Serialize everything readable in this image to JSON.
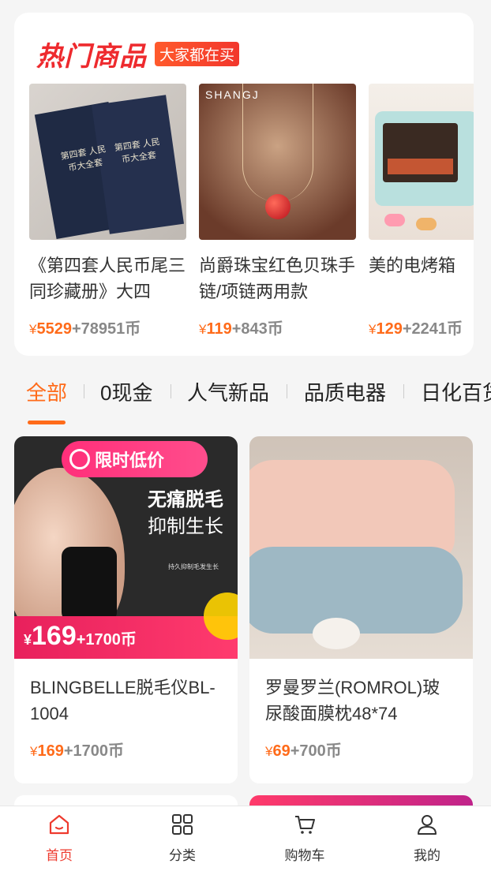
{
  "hot": {
    "title": "热门商品",
    "badge": "大家都在买",
    "items": [
      {
        "name": "《第四套人民币尾三同珍藏册》大四",
        "yen": "¥",
        "cash": "5529",
        "plus": "+78951币"
      },
      {
        "name": "尚爵珠宝红色贝珠手链/项链两用款",
        "yen": "¥",
        "cash": "119",
        "plus": "+843币"
      },
      {
        "name": "美的电烤箱",
        "yen": "¥",
        "cash": "129",
        "plus": "+2241币"
      }
    ],
    "img_texts": {
      "booklet_a": "第四套 人民币大全套",
      "booklet_b": "第四套 人民币大全套",
      "necklace_logo": "SHANGJ"
    }
  },
  "tabs": [
    "全部",
    "0现金",
    "人气新品",
    "品质电器",
    "日化百货"
  ],
  "products": [
    {
      "name": "BLINGBELLE脱毛仪BL-1004",
      "yen": "¥",
      "cash": "169",
      "plus": "+1700币",
      "banner": "限时低价",
      "slogan1": "无痛脱毛",
      "slogan2": "抑制生长",
      "small": "持久抑制毛发生长",
      "img_price_yen": "¥",
      "img_price_num": "169",
      "img_price_coin": "+1700币"
    },
    {
      "name": "罗曼罗兰(ROMROL)玻尿酸面膜枕48*74",
      "yen": "¥",
      "cash": "69",
      "plus": "+700币"
    }
  ],
  "nav": [
    {
      "label": "首页",
      "icon": "home-icon"
    },
    {
      "label": "分类",
      "icon": "grid-icon"
    },
    {
      "label": "购物车",
      "icon": "cart-icon"
    },
    {
      "label": "我的",
      "icon": "user-icon"
    }
  ],
  "colors": {
    "accent": "#ff6b1a",
    "red": "#ee2a2e",
    "pink": "#e8205c"
  }
}
